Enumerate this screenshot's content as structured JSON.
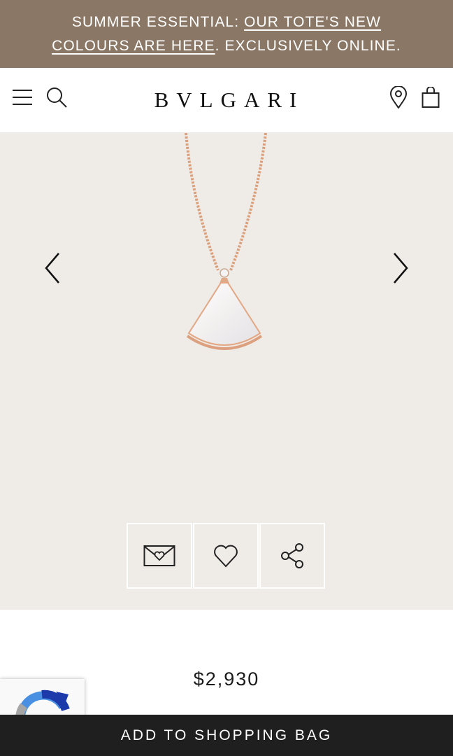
{
  "promo": {
    "prefix": "SUMMER ESSENTIAL: ",
    "link_text": "OUR TOTE'S NEW COLOURS ARE HERE",
    "suffix": ". EXCLUSIVELY ONLINE."
  },
  "header": {
    "logo": "BVLGARI",
    "icons": [
      "menu-icon",
      "search-icon",
      "store-locator-icon",
      "shopping-bag-icon"
    ]
  },
  "gallery": {
    "image": "rose-gold-necklace-mother-of-pearl-fan-pendant",
    "prev_icon": "chevron-left-icon",
    "next_icon": "chevron-right-icon",
    "actions": [
      "envelope-heart-icon",
      "heart-icon",
      "share-icon"
    ],
    "background": "#efebe7"
  },
  "product": {
    "price": "$2,930"
  },
  "cta": {
    "add_to_bag": "ADD TO SHOPPING BAG"
  },
  "colors": {
    "promo_bg": "#8b7765",
    "cta_bg": "#1f1f1f",
    "gold": "#d9a07b"
  }
}
